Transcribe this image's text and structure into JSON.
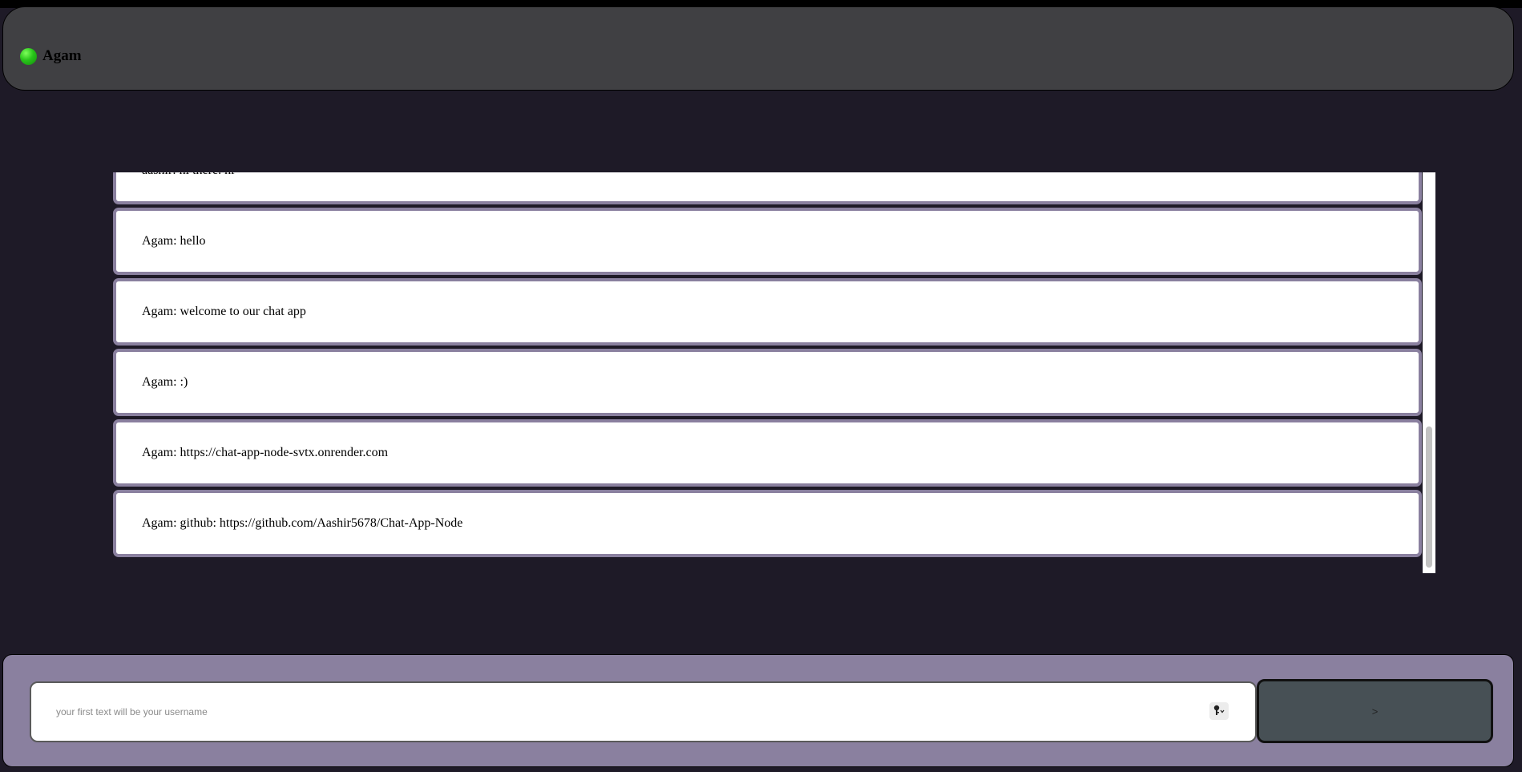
{
  "header": {
    "status_icon": "online-dot-icon",
    "status_color": "#28c41a",
    "username": "Agam"
  },
  "messages": [
    "aashir: hi there. hi",
    "Agam: hello",
    "Agam: welcome to our chat app",
    "Agam: :)",
    "Agam: https://chat-app-node-svtx.onrender.com",
    "Agam: github: https://github.com/Aashir5678/Chat-App-Node"
  ],
  "composer": {
    "placeholder": "your first text will be your username",
    "value": "",
    "key_icon": "key-icon",
    "send_label": ">"
  },
  "colors": {
    "page_background": "#1e1a27",
    "header_background": "#404043",
    "accent": "#8a809f",
    "send_button": "#475055"
  }
}
